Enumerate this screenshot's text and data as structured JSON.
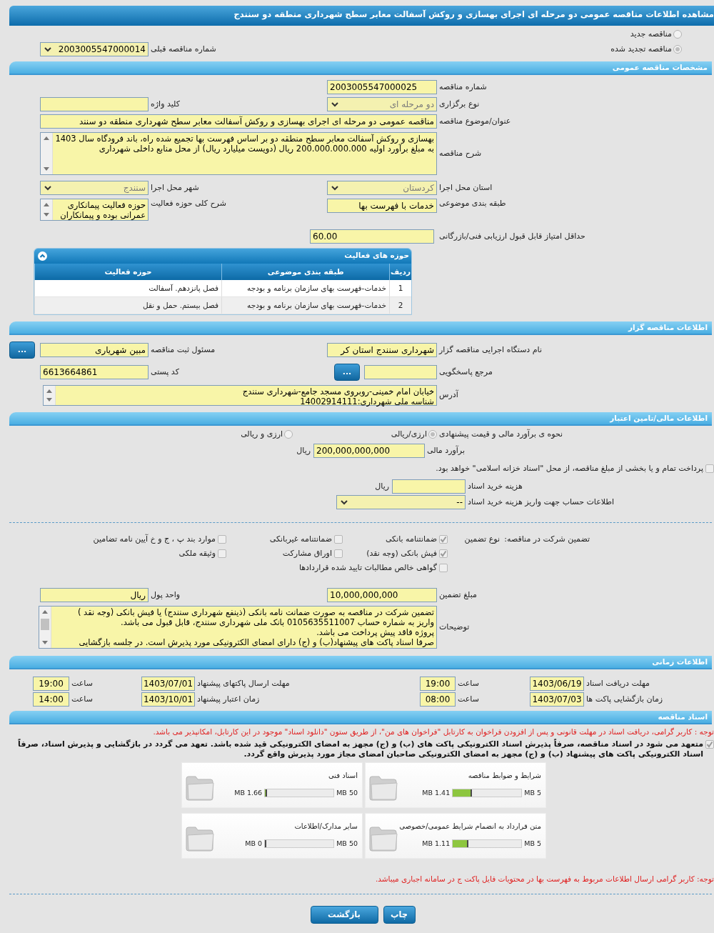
{
  "page_title": "مشاهده اطلاعات مناقصه عمومی دو مرحله ای اجرای بهسازی و روکش آسفالت معابر سطح شهرداری منطقه دو سنندج",
  "tender_status": [
    {
      "label": "مناقصه جدید",
      "selected": false
    },
    {
      "label": "مناقصه تجدید شده",
      "selected": true
    }
  ],
  "previous_tender": {
    "label": "شماره مناقصه قبلی",
    "value": "2003005547000014",
    "disabled": false
  },
  "general": {
    "title": "مشخصات مناقصه عمومی",
    "tender_number": {
      "label": "شماره مناقصه",
      "value": "2003005547000025"
    },
    "keyword": {
      "label": "کلید واژه"
    },
    "holding_type": {
      "label": "نوع برگزاری",
      "value": "دو مرحله ای",
      "disabled": true
    },
    "subject": {
      "label": "عنوان/موضوع مناقصه",
      "value": "مناقصه عمومی دو مرحله ای اجرای بهسازی و روکش آسفالت معابر سطح شهرداری منطقه دو سنند"
    },
    "description": {
      "label": "شرح مناقصه",
      "lines": [
        "بهسازی و روکش آسفالت معابر سطح منطقه دو بر اساس فهرست بها تجمیع شده راه، باند فرودگاه سال 1403",
        "به مبلغ برآورد اولیه 200.000.000.000 ریال (دویست میلیارد ریال) از محل منابع داخلی شهرداری"
      ]
    },
    "province": {
      "label": "استان محل اجرا",
      "value": "کردستان",
      "disabled": true
    },
    "city": {
      "label": "شهر محل اجرا",
      "value": "سنندج",
      "disabled": true
    },
    "category": {
      "label": "طبقه بندی موضوعی",
      "value": "خدمات با فهرست بها"
    },
    "activity_summary": {
      "label": "شرح کلی حوزه فعالیت",
      "lines": [
        "حوزه فعالیت پیمانکاری",
        "عمرانی بوده و پیمانکاران"
      ]
    },
    "min_score": {
      "label": "حداقل امتیاز قابل قبول ارزیابی فنی/بازرگانی",
      "value": "60.00"
    },
    "activity_table": {
      "title": "حوزه های فعالیت",
      "columns": [
        "ردیف",
        "طبقه بندی موضوعی",
        "حوزه فعالیت"
      ],
      "rows": [
        [
          "1",
          "خدمات-فهرست بهای سازمان برنامه و بودجه",
          "فصل پانزدهم. آسفالت"
        ],
        [
          "2",
          "خدمات-فهرست بهای سازمان برنامه و بودجه",
          "فصل بیستم. حمل و نقل"
        ]
      ]
    }
  },
  "organizer": {
    "title": "اطلاعات مناقصه گزار",
    "org_name": {
      "label": "نام دستگاه اجرایی مناقصه گزار",
      "value": "شهرداری سنندج استان کر"
    },
    "registrar": {
      "label": "مسئول ثبت مناقصه",
      "value": "مبین شهریاری",
      "button": "..."
    },
    "reference": {
      "label": "مرجع پاسخگویی",
      "button": "..."
    },
    "postal_code": {
      "label": "کد پستی",
      "value": "6613664861"
    },
    "address": {
      "label": "آدرس",
      "lines": [
        "خیابان امام خمینی-روبروی مسجد جامع-شهرداری سنندج",
        "شناسه ملی شهرداری:14002914111"
      ]
    }
  },
  "finance": {
    "title": "اطلاعات مالی/تامین اعتبار",
    "pricing": {
      "label": "نحوه ی برآورد مالی و قیمت پیشنهادی",
      "options": [
        {
          "label": "ارزی/ریالی",
          "selected": true
        },
        {
          "label": "ارزی و ریالی",
          "selected": false
        }
      ]
    },
    "estimate": {
      "label": "برآورد مالی",
      "value": "200,000,000,000",
      "unit": "ریال"
    },
    "treasury": {
      "label": "پرداخت تمام و یا بخشی از مبلغ مناقصه، از محل \"اسناد خزانه اسلامی\" خواهد بود.",
      "checked": false
    },
    "doc_fee": {
      "label": "هزینه خرید اسناد",
      "unit": "ریال"
    },
    "account": {
      "label": "اطلاعات حساب جهت واریز هزینه خرید اسناد",
      "value": "--",
      "disabled": false
    }
  },
  "guarantee": {
    "label": "تضمین شرکت در مناقصه:",
    "type_label": "نوع تضمین",
    "options": [
      {
        "label": "ضمانتنامه بانکی",
        "checked": true
      },
      {
        "label": "ضمانتنامه غیربانکی",
        "checked": false
      },
      {
        "label": "موارد بند پ ، ج و خ آیین نامه تضامین",
        "checked": false
      },
      {
        "label": "فیش بانکی (وجه نقد)",
        "checked": true
      },
      {
        "label": "اوراق مشارکت",
        "checked": false
      },
      {
        "label": "وثیقه ملکی",
        "checked": false
      },
      {
        "label": "گواهی خالص مطالبات تایید شده قراردادها",
        "checked": false
      }
    ],
    "amount": {
      "label": "مبلغ تضمین",
      "value": "10,000,000,000"
    },
    "currency": {
      "label": "واحد پول",
      "value": "ریال"
    },
    "notes": {
      "label": "توضیحات",
      "lines": [
        "تضمین شرکت در مناقصه به صورت ضمانت نامه بانکی (ذینفع شهرداری سنندج) یا فیش بانکی (وجه نقد )",
        "واریز به شماره حساب 0105635511007 بانک ملی شهرداری سنندج، قابل قبول می باشد.",
        "پروژه فاقد پیش پرداخت می باشد.",
        "صرفا اسناد پاکت های پیشنهاد(ب) و (ج) دارای امضای الکترونیکی مورد پذیرش است. در جلسه بازگشایی"
      ]
    }
  },
  "timing": {
    "title": "اطلاعات زمانی",
    "items": [
      {
        "label": "مهلت دریافت اسناد",
        "date": "1403/06/19",
        "time_label": "ساعت",
        "time": "19:00"
      },
      {
        "label": "مهلت ارسال پاکتهای پیشنهاد",
        "date": "1403/07/01",
        "time_label": "ساعت",
        "time": "19:00"
      },
      {
        "label": "زمان بازگشایی پاکت ها",
        "date": "1403/07/03",
        "time_label": "ساعت",
        "time": "08:00"
      },
      {
        "label": "زمان اعتبار پیشنهاد",
        "date": "1403/10/01",
        "time_label": "ساعت",
        "time": "14:00"
      }
    ]
  },
  "documents": {
    "title": "اسناد مناقصه",
    "notice": "توجه : کاربر گرامی، دریافت اسناد در مهلت قانونی و پس از افزودن فراخوان به کارتابل \"فراخوان های من\"، از طریق ستون \"دانلود اسناد\" موجود در این کارتابل، امکانپذیر می باشد.",
    "commitment": {
      "label": "متعهد می شود در اسناد مناقصه، صرفاً پذیرش اسناد الکترونیکی پاکت های (ب) و (ج) مجهز به امضای الکترونیکی قید شده باشد. تعهد می گردد در بازگشایی و پذیرش اسناد، صرفاً اسناد الکترونیکی پاکت های پیشنهاد (ب) و (ج) مجهز به امضای الکترونیکی صاحبان امضای مجاز مورد پذیرش واقع گردد.",
      "checked": true
    },
    "files": [
      {
        "name": "شرایط و ضوابط مناقصه",
        "size": "1.41 MB",
        "limit": "5 MB",
        "level": 0.282
      },
      {
        "name": "اسناد فنی",
        "size": "1.66 MB",
        "limit": "50 MB",
        "level": 0.033
      },
      {
        "name": "متن قرارداد به انضمام شرایط عمومی/خصوصی",
        "size": "1.11 MB",
        "limit": "5 MB",
        "level": 0.222
      },
      {
        "name": "سایر مدارک/اطلاعات",
        "size": "0 MB",
        "limit": "50 MB",
        "level": 0
      }
    ],
    "note": "توجه: کاربر گرامی ارسال اطلاعات مربوط به فهرست بها در محتویات فایل پاکت ج در سامانه اجباری میباشد."
  },
  "buttons": [
    "چاپ",
    "بازگشت"
  ]
}
